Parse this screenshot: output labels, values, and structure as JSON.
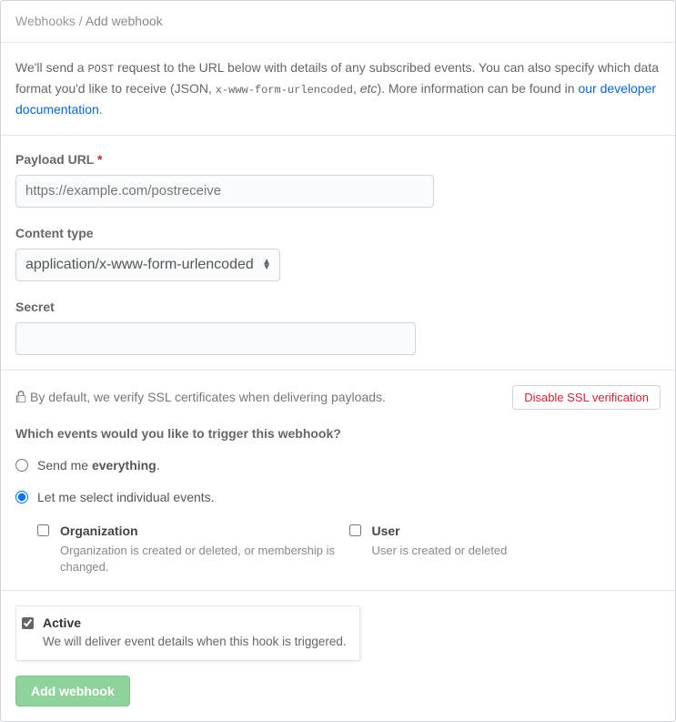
{
  "breadcrumb": {
    "parent": "Webhooks",
    "separator": "/",
    "current": "Add webhook"
  },
  "intro": {
    "prefix": "We'll send a ",
    "post": "POST",
    "mid1": " request to the URL below with details of any subscribed events. You can also specify which data format you'd like to receive (JSON, ",
    "enc": "x-www-form-urlencoded",
    "mid2": ", ",
    "etc": "etc",
    "mid3": "). More information can be found in ",
    "link": "our developer documentation",
    "end": "."
  },
  "payload": {
    "label": "Payload URL",
    "placeholder": "https://example.com/postreceive"
  },
  "content_type": {
    "label": "Content type",
    "selected": "application/x-www-form-urlencoded"
  },
  "secret": {
    "label": "Secret",
    "value": ""
  },
  "ssl": {
    "text": "By default, we verify SSL certificates when delivering payloads.",
    "button": "Disable SSL verification"
  },
  "events": {
    "title": "Which events would you like to trigger this webhook?",
    "everything_pre": "Send me ",
    "everything_bold": "everything",
    "everything_post": ".",
    "individual": "Let me select individual events.",
    "organization": {
      "title": "Organization",
      "desc": "Organization is created or deleted, or membership is changed."
    },
    "user": {
      "title": "User",
      "desc": "User is created or deleted"
    }
  },
  "active": {
    "title": "Active",
    "desc": "We will deliver event details when this hook is triggered."
  },
  "submit": {
    "label": "Add webhook"
  }
}
